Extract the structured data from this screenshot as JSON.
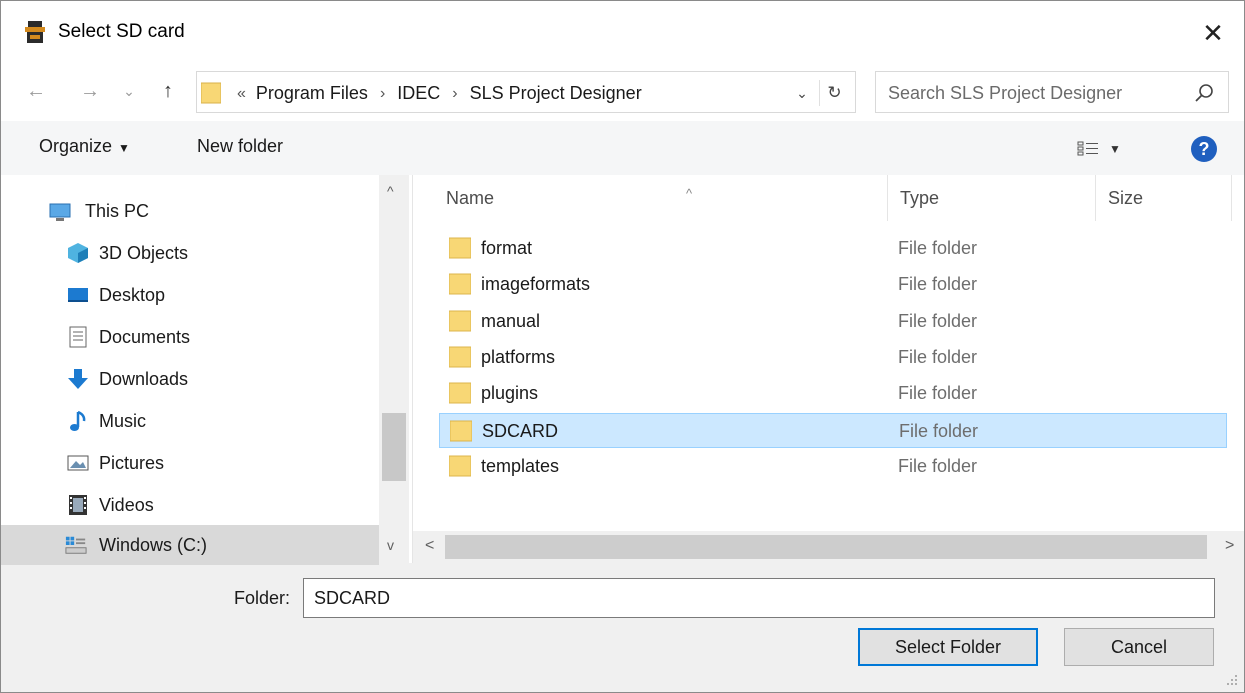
{
  "window": {
    "title": "Select SD card",
    "close_glyph": "✕"
  },
  "nav": {
    "back_glyph": "←",
    "forward_glyph": "→",
    "recent_glyph": "⌄",
    "up_glyph": "↑",
    "breadcrumb_lead": "«",
    "breadcrumbs": [
      "Program Files",
      "IDEC",
      "SLS Project Designer"
    ],
    "crumb_sep": "›",
    "dropdown_glyph": "⌄",
    "refresh_glyph": "↻",
    "search_placeholder": "Search SLS Project Designer"
  },
  "toolbar": {
    "organize_label": "Organize",
    "caret": "▼",
    "new_folder_label": "New folder",
    "help_glyph": "?"
  },
  "sidebar": {
    "items": [
      {
        "label": "This PC",
        "icon": "pc-icon"
      },
      {
        "label": "3D Objects",
        "icon": "3d-objects-icon"
      },
      {
        "label": "Desktop",
        "icon": "desktop-icon"
      },
      {
        "label": "Documents",
        "icon": "documents-icon"
      },
      {
        "label": "Downloads",
        "icon": "downloads-icon"
      },
      {
        "label": "Music",
        "icon": "music-icon"
      },
      {
        "label": "Pictures",
        "icon": "pictures-icon"
      },
      {
        "label": "Videos",
        "icon": "videos-icon"
      },
      {
        "label": "Windows (C:)",
        "icon": "drive-icon",
        "selected": true
      }
    ],
    "scroll_up": "^",
    "scroll_down": "v"
  },
  "files": {
    "columns": {
      "name": "Name",
      "type": "Type",
      "size": "Size",
      "sort_glyph": "^"
    },
    "rows": [
      {
        "name": "format",
        "type": "File folder"
      },
      {
        "name": "imageformats",
        "type": "File folder"
      },
      {
        "name": "manual",
        "type": "File folder"
      },
      {
        "name": "platforms",
        "type": "File folder"
      },
      {
        "name": "plugins",
        "type": "File folder"
      },
      {
        "name": "SDCARD",
        "type": "File folder",
        "selected": true
      },
      {
        "name": "templates",
        "type": "File folder"
      }
    ],
    "scroll_left": "<",
    "scroll_right": ">"
  },
  "footer": {
    "folder_label": "Folder:",
    "folder_value": "SDCARD",
    "select_label": "Select Folder",
    "cancel_label": "Cancel"
  },
  "colors": {
    "accent": "#0078d7",
    "selection_bg": "#cce8ff",
    "folder_yellow": "#f8d775",
    "help_blue": "#1f5fbf"
  }
}
